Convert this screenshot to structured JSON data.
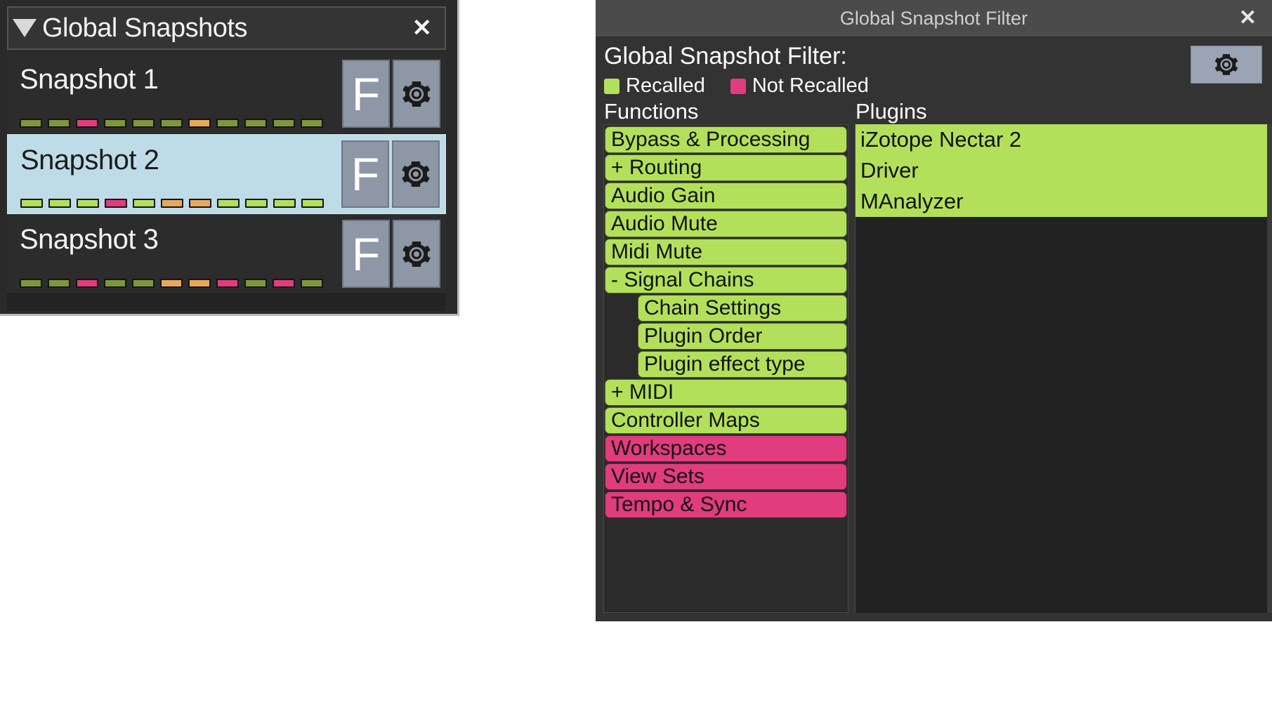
{
  "snapshots_panel": {
    "title": "Global Snapshots",
    "disclosure_icon": "triangle-down-icon",
    "close_label": "✕",
    "button_f_label": "F",
    "gear_icon": "gear-icon",
    "led_colors": {
      "green_dim": "#7f9639",
      "green_bright": "#b3e05a",
      "pink": "#e13c7d",
      "orange": "#e8a85a"
    },
    "rows": [
      {
        "name": "Snapshot 1",
        "selected": false,
        "leds": [
          "green_dim",
          "green_dim",
          "pink",
          "green_dim",
          "green_dim",
          "green_dim",
          "orange",
          "green_dim",
          "green_dim",
          "green_dim",
          "green_dim"
        ]
      },
      {
        "name": "Snapshot 2",
        "selected": true,
        "leds": [
          "green_bright",
          "green_bright",
          "green_bright",
          "pink",
          "green_bright",
          "orange",
          "orange",
          "green_bright",
          "green_bright",
          "green_bright",
          "green_bright"
        ]
      },
      {
        "name": "Snapshot 3",
        "selected": false,
        "leds": [
          "green_dim",
          "green_dim",
          "pink",
          "green_dim",
          "green_dim",
          "orange",
          "orange",
          "pink",
          "green_dim",
          "pink",
          "green_dim"
        ]
      }
    ]
  },
  "filter_panel": {
    "window_title": "Global Snapshot Filter",
    "close_label": "✕",
    "heading": "Global Snapshot Filter:",
    "settings_icon": "gear-icon",
    "legend": [
      {
        "label": "Recalled",
        "color": "#b3e05a"
      },
      {
        "label": "Not Recalled",
        "color": "#e13c7d"
      }
    ],
    "functions_heading": "Functions",
    "plugins_heading": "Plugins",
    "functions": [
      {
        "label": "Bypass & Processing",
        "state": "recalled",
        "indent": false
      },
      {
        "label": "+  Routing",
        "state": "recalled",
        "indent": false
      },
      {
        "label": "Audio Gain",
        "state": "recalled",
        "indent": false
      },
      {
        "label": "Audio Mute",
        "state": "recalled",
        "indent": false
      },
      {
        "label": "Midi Mute",
        "state": "recalled",
        "indent": false
      },
      {
        "label": "-  Signal Chains",
        "state": "recalled",
        "indent": false
      },
      {
        "label": "Chain Settings",
        "state": "recalled",
        "indent": true
      },
      {
        "label": "Plugin Order",
        "state": "recalled",
        "indent": true
      },
      {
        "label": "Plugin effect type",
        "state": "recalled",
        "indent": true
      },
      {
        "label": "+  MIDI",
        "state": "recalled",
        "indent": false
      },
      {
        "label": "Controller Maps",
        "state": "recalled",
        "indent": false
      },
      {
        "label": "Workspaces",
        "state": "not-recalled",
        "indent": false
      },
      {
        "label": "View Sets",
        "state": "not-recalled",
        "indent": false
      },
      {
        "label": "Tempo & Sync",
        "state": "not-recalled",
        "indent": false
      }
    ],
    "plugins": [
      {
        "label": "iZotope Nectar 2",
        "state": "recalled"
      },
      {
        "label": "Driver",
        "state": "recalled"
      },
      {
        "label": "MAnalyzer",
        "state": "recalled"
      }
    ]
  }
}
